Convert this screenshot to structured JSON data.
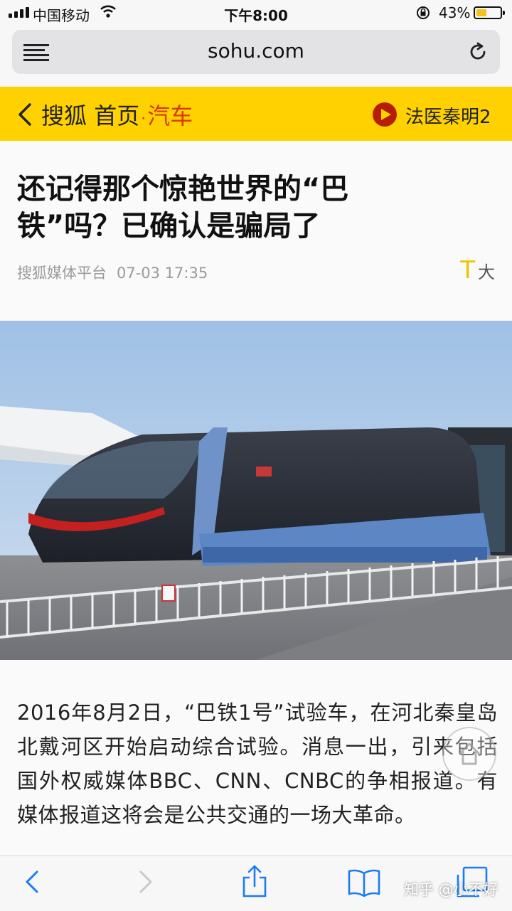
{
  "status_bar": {
    "carrier": "中国移动",
    "time": "下午8:00",
    "battery_percent": "43%",
    "battery_level": 0.43,
    "battery_color": "#f4c21c"
  },
  "browser": {
    "url": "sohu.com"
  },
  "site_header": {
    "brand": "搜狐",
    "home": "首页",
    "separator": "·",
    "category": "汽车",
    "promo": "法医秦明2",
    "accent_color": "#ffd100",
    "category_color": "#d43b00"
  },
  "article": {
    "title": "还记得那个惊艳世界的“巴铁”吗？已确认是骗局了",
    "source": "搜狐媒体平台",
    "date": "07-03 17:35",
    "font_toggle_icon": "T",
    "font_toggle_label": "大",
    "image_alt": "elevated-bus-train-photo",
    "body": "2016年8月2日，“巴铁1号”试验车，在河北秦皇岛北戴河区开始启动综合试验。消息一出，引来包括国外权威媒体BBC、CNN、CNBC的争相报道。有媒体报道这将会是公共交通的一场大革命。"
  },
  "toolbar": {
    "icons": [
      "back-icon",
      "forward-icon",
      "share-icon",
      "bookmarks-icon",
      "tabs-icon"
    ]
  },
  "watermark": "知乎 @小不好"
}
